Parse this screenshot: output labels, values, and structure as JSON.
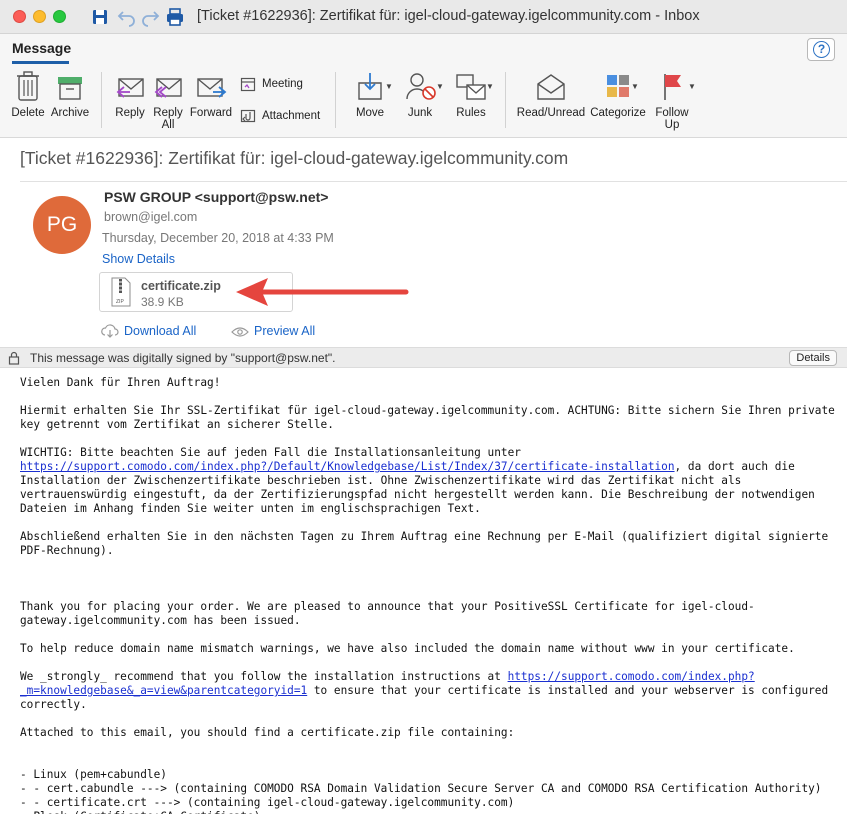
{
  "window": {
    "title": "[Ticket #1622936]: Zertifikat für: igel-cloud-gateway.igelcommunity.com - Inbox"
  },
  "ribbon": {
    "active_tab": "Message",
    "help_symbol": "?"
  },
  "toolbar": {
    "delete": "Delete",
    "archive": "Archive",
    "reply": "Reply",
    "reply_all_1": "Reply",
    "reply_all_2": "All",
    "forward": "Forward",
    "meeting": "Meeting",
    "attachment": "Attachment",
    "move": "Move",
    "junk": "Junk",
    "rules": "Rules",
    "read_unread": "Read/Unread",
    "categorize": "Categorize",
    "follow_up_1": "Follow",
    "follow_up_2": "Up"
  },
  "message": {
    "subject": "[Ticket #1622936]: Zertifikat für: igel-cloud-gateway.igelcommunity.com",
    "avatar_initials": "PG",
    "sender": "PSW GROUP <support@psw.net>",
    "recipient": "brown@igel.com",
    "datetime": "Thursday, December 20, 2018 at 4:33 PM",
    "show_details": "Show Details",
    "attachment": {
      "name": "certificate.zip",
      "size": "38.9 KB"
    },
    "download_all": "Download All",
    "preview_all": "Preview All",
    "signature_text": "This message was digitally signed by \"support@psw.net\".",
    "details_button": "Details"
  },
  "body": {
    "p1": "Vielen Dank für Ihren Auftrag!",
    "p2": "Hiermit erhalten Sie Ihr SSL-Zertifikat für igel-cloud-gateway.igelcommunity.com. ACHTUNG: Bitte sichern Sie Ihren private\nkey getrennt vom Zertifikat an sicherer Stelle.",
    "p3a": "WICHTIG: Bitte beachten Sie auf jeden Fall die Installationsanleitung unter",
    "link1": "https://support.comodo.com/index.php?/Default/Knowledgebase/List/Index/37/certificate-installation",
    "p3b": ", da dort auch die",
    "p3c": "Installation der Zwischenzertifikate beschrieben ist. Ohne Zwischenzertifikate wird das Zertifikat nicht als\nvertrauenswürdig eingestuft, da der Zertifizierungspfad nicht hergestellt werden kann. Die Beschreibung der notwendigen\nDateien im Anhang finden Sie weiter unten im englischsprachigen Text.",
    "p4": "Abschließend erhalten Sie in den nächsten Tagen zu Ihrem Auftrag eine Rechnung per E-Mail (qualifiziert digital signierte\nPDF-Rechnung).",
    "p5": "Thank you for placing your order. We are pleased to announce that your PositiveSSL Certificate for igel-cloud-\ngateway.igelcommunity.com has been issued.",
    "p6": "To help reduce domain name mismatch warnings, we have also included the domain name without www in your certificate.",
    "p7a": "We _strongly_ recommend that you follow the installation instructions at ",
    "link2a": "https://support.comodo.com/index.php?",
    "link2b": "_m=knowledgebase&_a=view&parentcategoryid=1",
    "p7b": " to ensure that your certificate is installed and your webserver is configured",
    "p7c": "correctly.",
    "p8": "Attached to this email, you should find a certificate.zip file containing:",
    "p9": "- Linux (pem+cabundle)\n- - cert.cabundle ---> (containing COMODO RSA Domain Validation Secure Server CA and COMODO RSA Certification Authority)\n- - certificate.crt ---> (containing igel-cloud-gateway.igelcommunity.com)\n- Plesk (Certificate+CA-Certificate)"
  },
  "colors": {
    "avatar": "#df6a3a",
    "link": "#1a64c7",
    "arrow": "#e5453e",
    "tab_underline": "#1e5fa8"
  }
}
